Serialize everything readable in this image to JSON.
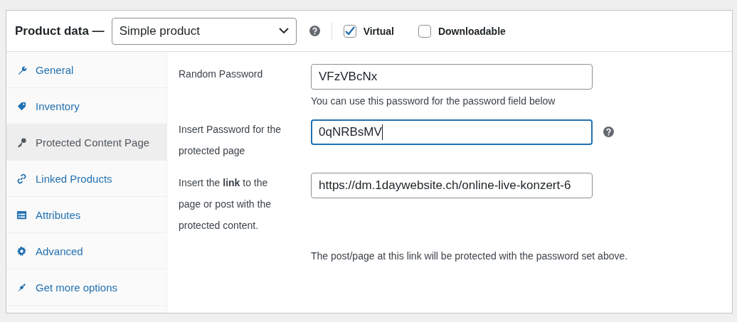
{
  "header": {
    "title": "Product data —",
    "product_type": "Simple product",
    "options": [
      {
        "label": "Virtual",
        "checked": true
      },
      {
        "label": "Downloadable",
        "checked": false
      }
    ]
  },
  "tabs": [
    {
      "label": "General",
      "selected": false
    },
    {
      "label": "Inventory",
      "selected": false
    },
    {
      "label": "Protected Content Page",
      "selected": true
    },
    {
      "label": "Linked Products",
      "selected": false
    },
    {
      "label": "Attributes",
      "selected": false
    },
    {
      "label": "Advanced",
      "selected": false
    },
    {
      "label": "Get more options",
      "selected": false
    }
  ],
  "fields": [
    {
      "label": "Random Password",
      "value": "VFzVBcNx",
      "focused": false,
      "help": false,
      "description": "You can use this password for the password field below"
    },
    {
      "label": "Insert Password for the protected page",
      "value": "0qNRBsMV",
      "focused": true,
      "help": true
    },
    {
      "label": "Insert the **link** to the page or post with the protected content.",
      "value": "https://dm.1daywebsite.ch/online-live-konzert-6",
      "focused": false,
      "help": false,
      "description": "The post/page at this link will be protected with the password set above."
    }
  ]
}
